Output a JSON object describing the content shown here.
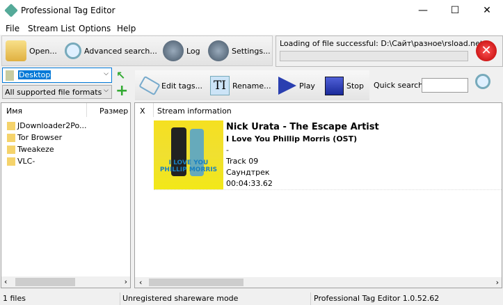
{
  "window": {
    "title": "Professional Tag Editor",
    "minimize": "—",
    "maximize": "☐",
    "close": "✕"
  },
  "menu": [
    "File",
    "Stream List",
    "Options",
    "Help"
  ],
  "toolbar": {
    "open": "Open...",
    "advanced_search": "Advanced search...",
    "log": "Log",
    "settings": "Settings..."
  },
  "status_panel": {
    "message": "Loading of file successful: D:\\Сайт\\разное\\rsload.net.m",
    "progress": 0
  },
  "left": {
    "folder": "Desktop",
    "filter": "All supported file formats",
    "columns": [
      "Имя",
      "Размер"
    ],
    "items": [
      "JDownloader2Po...",
      "Tor Browser",
      "Tweakeze",
      "VLC-"
    ]
  },
  "right_toolbar": {
    "edit_tags": "Edit tags...",
    "rename": "Rename...",
    "play": "Play",
    "stop": "Stop",
    "quick_search_label": "Quick search:",
    "quick_search_value": ""
  },
  "stream": {
    "columns": [
      "X",
      "Stream information"
    ],
    "title": "Nick Urata - The Escape Artist",
    "album": "I Love You Phillip Morris (OST)",
    "dash": "-",
    "track": "Track 09",
    "genre": "Саундтрек",
    "duration": "00:04:33.62",
    "cover_text": "I LOVE YOU PHILLIP MORRIS"
  },
  "statusbar": {
    "files": "1 files",
    "mode": "Unregistered shareware mode",
    "version": "Professional Tag Editor 1.0.52.62"
  }
}
